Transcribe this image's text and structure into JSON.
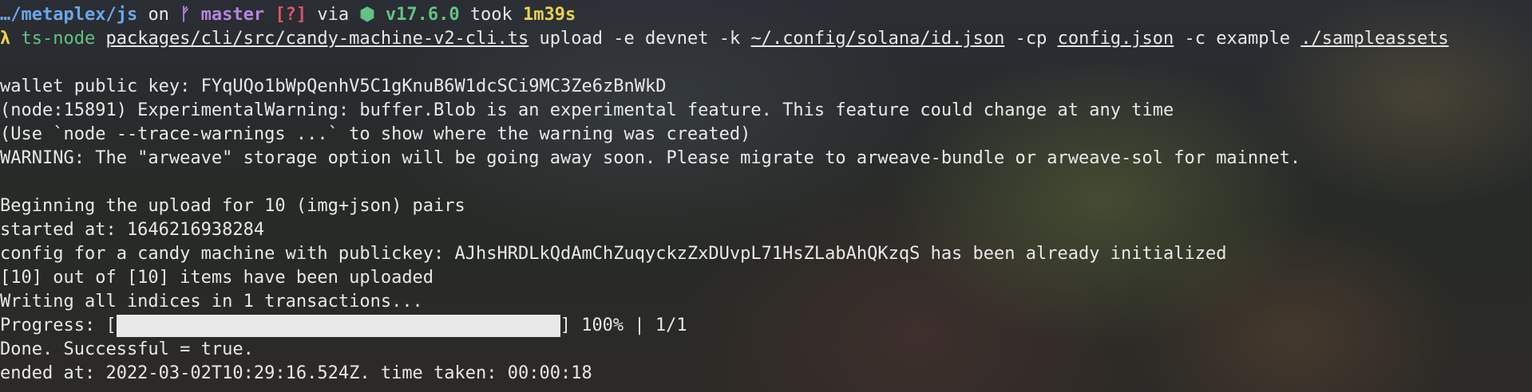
{
  "prompt": {
    "path": "…/metaplex/js",
    "on": "on",
    "branch_icon": "git-branch-icon",
    "branch_glyph": "ᚠ",
    "branch": "master",
    "git_status": "[?]",
    "via": "via",
    "node_icon": "nodejs-icon",
    "node_glyph": "⬢",
    "node_version": "v17.6.0",
    "took": "took",
    "duration": "1m39s"
  },
  "command": {
    "lambda": "λ",
    "program": "ts-node",
    "script": "packages/cli/src/candy-machine-v2-cli.ts",
    "arg1": "upload -e devnet -k",
    "keypair": "~/.config/solana/id.json",
    "arg2": "-cp",
    "config": "config.json",
    "arg3": "-c example",
    "assets": "./sampleassets"
  },
  "output": {
    "wallet": "wallet public key: FYqUQo1bWpQenhV5C1gKnuB6W1dcSCi9MC3Ze6zBnWkD",
    "warning1": "(node:15891) ExperimentalWarning: buffer.Blob is an experimental feature. This feature could change at any time",
    "warning2": "(Use `node --trace-warnings ...` to show where the warning was created)",
    "warning3": "WARNING: The \"arweave\" storage option will be going away soon. Please migrate to arweave-bundle or arweave-sol for mainnet.",
    "beginning": "Beginning the upload for 10 (img+json) pairs",
    "started": "started at: 1646216938284",
    "config_line": "config for a candy machine with publickey: AJhsHRDLkQdAmChZuqyckzZxDUvpL71HsZLabAhQKzqS has been already initialized",
    "uploaded": "[10] out of [10] items have been uploaded",
    "writing": "Writing all indices in 1 transactions...",
    "progress_prefix": "Progress: [",
    "progress_value": 1.0,
    "progress_suffix": "] 100% | 1/1",
    "done": "Done. Successful = true.",
    "ended": "ended at: 2022-03-02T10:29:16.524Z. time taken: 00:00:18"
  }
}
